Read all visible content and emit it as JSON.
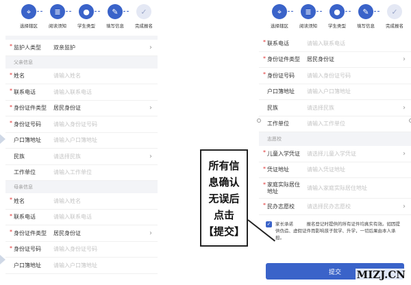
{
  "steps": [
    {
      "label": "选择辖区",
      "icon": "location-icon"
    },
    {
      "label": "阅读须知",
      "icon": "document-icon"
    },
    {
      "label": "学生类型",
      "icon": "student-icon"
    },
    {
      "label": "填写信息",
      "icon": "form-icon"
    },
    {
      "label": "完成报名",
      "icon": "check-icon"
    }
  ],
  "left": {
    "guardian": {
      "label": "监护人类型",
      "value": "双亲监护"
    },
    "father_section": "父亲信息",
    "father": {
      "name": {
        "label": "姓名",
        "placeholder": "请输入姓名"
      },
      "phone": {
        "label": "联系电话",
        "placeholder": "请输入联系电话"
      },
      "id_type": {
        "label": "身份证件类型",
        "value": "居民身份证"
      },
      "id_no": {
        "label": "身份证号码",
        "placeholder": "请输入身份证号码"
      },
      "hukou": {
        "label": "户口簿地址",
        "placeholder": "请输入户口簿地址"
      },
      "ethnic": {
        "label": "民族",
        "placeholder": "请选择民族"
      },
      "work": {
        "label": "工作单位",
        "placeholder": "请输入工作单位"
      }
    },
    "mother_section": "母亲信息",
    "mother": {
      "name": {
        "label": "姓名",
        "placeholder": "请输入姓名"
      },
      "phone": {
        "label": "联系电话",
        "placeholder": "请输入联系电话"
      },
      "id_type": {
        "label": "身份证件类型",
        "value": "居民身份证"
      },
      "id_no": {
        "label": "身份证号码",
        "placeholder": "请输入身份证号码"
      },
      "hukou": {
        "label": "户口簿地址",
        "placeholder": "请输入户口簿地址"
      }
    }
  },
  "right": {
    "phone": {
      "label": "联系电话",
      "placeholder": "请输入联系电话"
    },
    "id_type": {
      "label": "身份证件类型",
      "value": "居民身份证"
    },
    "id_no": {
      "label": "身份证号码",
      "placeholder": "请输入身份证号码"
    },
    "hukou": {
      "label": "户口簿地址",
      "placeholder": "请输入户口簿地址"
    },
    "ethnic": {
      "label": "民族",
      "placeholder": "请选择民族"
    },
    "work": {
      "label": "工作单位",
      "placeholder": "请输入工作单位"
    },
    "wish_section": "志愿校",
    "cert": {
      "label": "儿童入学凭证",
      "placeholder": "请选择儿童入学凭证"
    },
    "cert_addr": {
      "label": "凭证地址",
      "placeholder": "请输入凭证地址"
    },
    "home_addr": {
      "label": "家庭实际居住地址",
      "placeholder": "请输入家庭实际居住地址"
    },
    "school": {
      "label": "民办志愿校",
      "placeholder": "请选择民办志愿校"
    },
    "consent": "家长承诺　　　报名登记时提供的所有证件均真实有效。如因提供伪造、虚假证件而影响孩子就学、升学，一切后果由本人承担。",
    "submit": "提交"
  },
  "callout": [
    "所有信",
    "息确认",
    "无误后",
    "点击",
    "【提交】"
  ],
  "watermark": "MIZJ.CN",
  "colors": {
    "accent": "#3a63c9",
    "required": "#e03030"
  }
}
